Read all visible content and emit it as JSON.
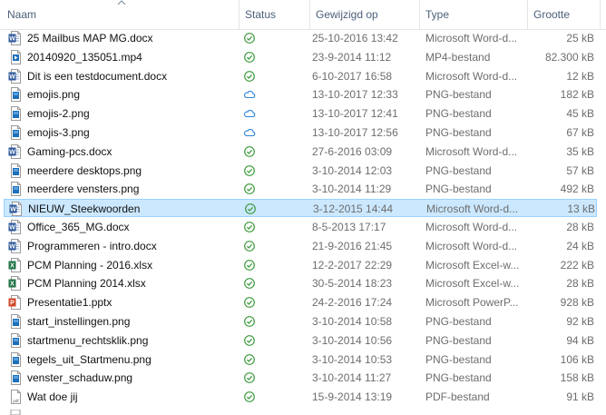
{
  "columns": {
    "name": "Naam",
    "status": "Status",
    "modified": "Gewijzigd op",
    "type": "Type",
    "size": "Grootte"
  },
  "sort": {
    "column": "name",
    "direction": "ascending"
  },
  "colors": {
    "word": "#2b579a",
    "excel": "#217346",
    "powerpoint": "#d24726",
    "synced": "#3c9a3c",
    "cloud": "#2e86de",
    "selected_bg": "#cce8ff",
    "selected_border": "#99d1ff"
  },
  "files": [
    {
      "name": "25 Mailbus MAP MG.docx",
      "icon": "word-doc-icon",
      "status": "synced",
      "modified": "25-10-2016 13:42",
      "type": "Microsoft Word-d...",
      "size": "25 kB"
    },
    {
      "name": "20140920_135051.mp4",
      "icon": "video-file-icon",
      "status": "synced",
      "modified": "23-9-2014 11:12",
      "type": "MP4-bestand",
      "size": "82.300 kB"
    },
    {
      "name": "Dit is een testdocument.docx",
      "icon": "word-doc-icon",
      "status": "synced",
      "modified": "6-10-2017 16:58",
      "type": "Microsoft Word-d...",
      "size": "12 kB"
    },
    {
      "name": "emojis.png",
      "icon": "image-file-icon",
      "status": "cloud",
      "modified": "13-10-2017 12:33",
      "type": "PNG-bestand",
      "size": "182 kB"
    },
    {
      "name": "emojis-2.png",
      "icon": "image-file-icon",
      "status": "cloud",
      "modified": "13-10-2017 12:41",
      "type": "PNG-bestand",
      "size": "45 kB"
    },
    {
      "name": "emojis-3.png",
      "icon": "image-file-icon",
      "status": "cloud",
      "modified": "13-10-2017 12:56",
      "type": "PNG-bestand",
      "size": "67 kB"
    },
    {
      "name": "Gaming-pcs.docx",
      "icon": "word-doc-icon",
      "status": "synced",
      "modified": "27-6-2016 03:09",
      "type": "Microsoft Word-d...",
      "size": "35 kB"
    },
    {
      "name": "meerdere desktops.png",
      "icon": "image-file-icon",
      "status": "synced",
      "modified": "3-10-2014 12:03",
      "type": "PNG-bestand",
      "size": "57 kB"
    },
    {
      "name": "meerdere vensters.png",
      "icon": "image-file-icon",
      "status": "synced",
      "modified": "3-10-2014 11:29",
      "type": "PNG-bestand",
      "size": "492 kB"
    },
    {
      "name": "NIEUW_Steekwoorden",
      "icon": "word-doc-icon",
      "status": "synced",
      "modified": "3-12-2015 14:44",
      "type": "Microsoft Word-d...",
      "size": "13 kB",
      "selected": true
    },
    {
      "name": "Office_365_MG.docx",
      "icon": "word-doc-icon",
      "status": "synced",
      "modified": "8-5-2013 17:17",
      "type": "Microsoft Word-d...",
      "size": "28 kB"
    },
    {
      "name": "Programmeren - intro.docx",
      "icon": "word-doc-icon",
      "status": "synced",
      "modified": "21-9-2016 21:45",
      "type": "Microsoft Word-d...",
      "size": "24 kB"
    },
    {
      "name": "PCM Planning - 2016.xlsx",
      "icon": "excel-file-icon",
      "status": "synced",
      "modified": "12-2-2017 22:29",
      "type": "Microsoft Excel-w...",
      "size": "222 kB"
    },
    {
      "name": "PCM Planning 2014.xlsx",
      "icon": "excel-file-icon",
      "status": "synced",
      "modified": "30-5-2014 18:23",
      "type": "Microsoft Excel-w...",
      "size": "28 kB"
    },
    {
      "name": "Presentatie1.pptx",
      "icon": "powerpoint-file-icon",
      "status": "synced",
      "modified": "24-2-2016 17:24",
      "type": "Microsoft PowerP...",
      "size": "928 kB"
    },
    {
      "name": "start_instellingen.png",
      "icon": "image-file-icon",
      "status": "synced",
      "modified": "3-10-2014 10:58",
      "type": "PNG-bestand",
      "size": "92 kB"
    },
    {
      "name": "startmenu_rechtsklik.png",
      "icon": "image-file-icon",
      "status": "synced",
      "modified": "3-10-2014 10:56",
      "type": "PNG-bestand",
      "size": "94 kB"
    },
    {
      "name": "tegels_uit_Startmenu.png",
      "icon": "image-file-icon",
      "status": "synced",
      "modified": "3-10-2014 10:53",
      "type": "PNG-bestand",
      "size": "106 kB"
    },
    {
      "name": "venster_schaduw.png",
      "icon": "image-file-icon",
      "status": "synced",
      "modified": "3-10-2014 11:27",
      "type": "PNG-bestand",
      "size": "158 kB"
    },
    {
      "name": "Wat doe jij",
      "icon": "pdf-file-icon",
      "status": "synced",
      "modified": "15-9-2014 13:19",
      "type": "PDF-bestand",
      "size": "91 kB"
    }
  ]
}
